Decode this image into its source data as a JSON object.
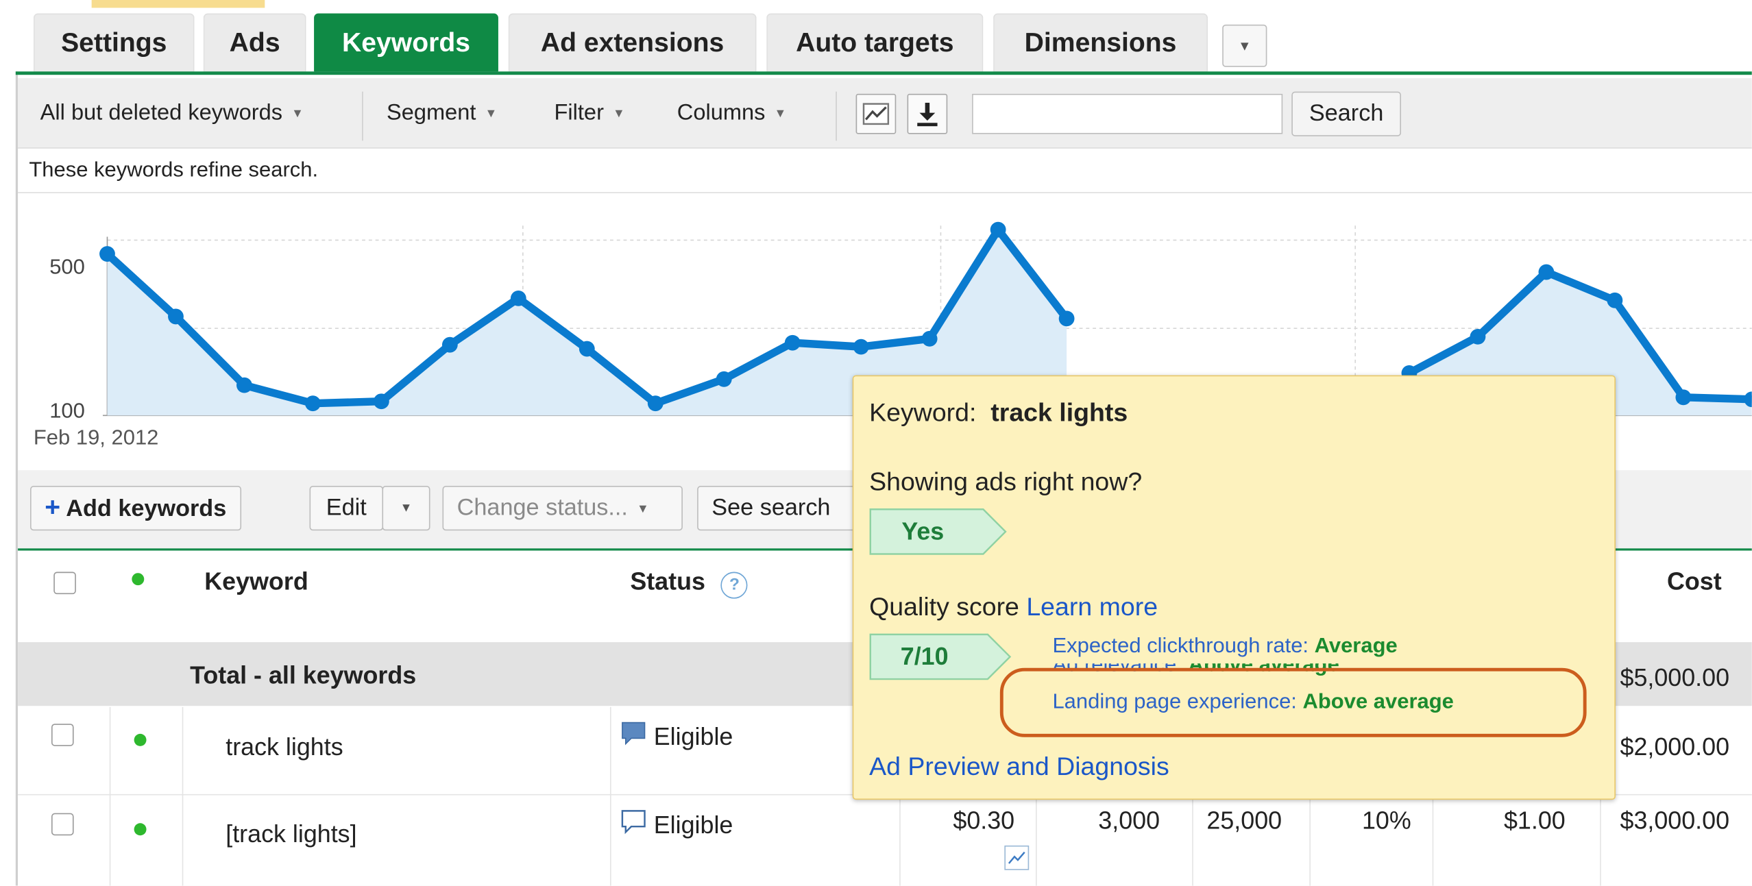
{
  "tabs": [
    {
      "label": "Settings",
      "active": false
    },
    {
      "label": "Ads",
      "active": false
    },
    {
      "label": "Keywords",
      "active": true
    },
    {
      "label": "Ad extensions",
      "active": false
    },
    {
      "label": "Auto targets",
      "active": false
    },
    {
      "label": "Dimensions",
      "active": false
    }
  ],
  "toolbar": {
    "view_filter": "All but deleted keywords",
    "segment": "Segment",
    "filter": "Filter",
    "columns": "Columns",
    "search_value": "",
    "search_button": "Search"
  },
  "refine_text": "These keywords refine search.",
  "chart_data": {
    "type": "area",
    "y_ticks": [
      "500",
      "100"
    ],
    "x_start_label": "Feb 19, 2012",
    "ylim": [
      100,
      570
    ],
    "grid": true,
    "series": [
      {
        "color": "#0a7bcf",
        "values": [
          500,
          345,
          175,
          130,
          135,
          275,
          390,
          265,
          130,
          190,
          280,
          270,
          290,
          560,
          340,
          null,
          null,
          null,
          null,
          205,
          295,
          455,
          385,
          145,
          140
        ]
      }
    ]
  },
  "actions": {
    "add_keywords": "Add keywords",
    "edit": "Edit",
    "change_status": "Change status...",
    "see_search": "See search"
  },
  "table": {
    "headers": {
      "keyword": "Keyword",
      "status": "Status",
      "cost": "Cost"
    },
    "total": {
      "label": "Total - all keywords",
      "cost": "$5,000.00"
    },
    "rows": [
      {
        "keyword": "track lights",
        "status": "Eligible",
        "cost": "$2,000.00"
      },
      {
        "keyword": "[track lights]",
        "status": "Eligible",
        "max_cpc": "$0.30",
        "clicks": "3,000",
        "impressions": "25,000",
        "ctr": "10%",
        "avg_cpc": "$1.00",
        "cost": "$3,000.00"
      }
    ]
  },
  "tooltip": {
    "keyword_label": "Keyword:",
    "keyword_value": "track lights",
    "showing_question": "Showing ads right now?",
    "showing_answer": "Yes",
    "quality_label": "Quality score",
    "learn_more": "Learn more",
    "quality_score": "7/10",
    "factors": [
      {
        "name": "Expected clickthrough rate:",
        "value": "Average"
      },
      {
        "name": "Ad relevance:",
        "value": "Above average"
      },
      {
        "name": "Landing page experience:",
        "value": "Above average"
      }
    ],
    "diagnosis_link": "Ad Preview and Diagnosis"
  },
  "colors": {
    "accent_green": "#0f8a45",
    "chart_blue": "#0a7bcf",
    "highlight_orange": "#cc5d1d"
  }
}
